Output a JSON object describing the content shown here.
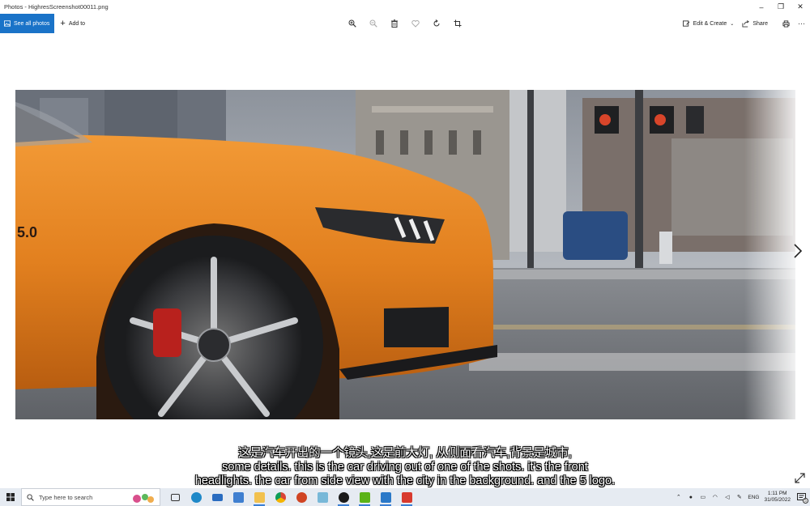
{
  "window": {
    "title": "Photos - HighresScreenshot00011.png",
    "minimize_glyph": "–",
    "maximize_glyph": "❐",
    "close_glyph": "✕"
  },
  "toolbar": {
    "see_all_label": "See all photos",
    "add_to_label": "Add to",
    "center_tools": [
      "zoom-in-icon",
      "zoom-out-icon",
      "delete-icon",
      "favorite-icon",
      "rotate-icon",
      "crop-icon"
    ],
    "edit_create_label": "Edit & Create",
    "share_label": "Share",
    "more_glyph": "···"
  },
  "subtitles": {
    "line1": "这是汽车开出的一个镜头,这是前大灯, 从侧面看汽车,背景是城市,",
    "line2": "some details. this is the car driving out of one of the shots. it's the front",
    "line3": "headlights. the car from side view with the city in the background. and the 5 logo."
  },
  "photo": {
    "badge_text": "5.0",
    "car_color": "#e2801f"
  },
  "taskbar": {
    "search_placeholder": "Type here to search",
    "apps": [
      "task-view",
      "edge",
      "mail",
      "store",
      "file-explorer",
      "chrome",
      "powerpoint",
      "pen",
      "unreal",
      "nvidia",
      "photos",
      "red-app"
    ],
    "lang": "ENG",
    "time": "1:11 PM",
    "date": "31/05/2022",
    "notification_count": "5"
  },
  "colors": {
    "accent": "#1a73c8",
    "taskbar_bg": "#e6ebf2"
  }
}
